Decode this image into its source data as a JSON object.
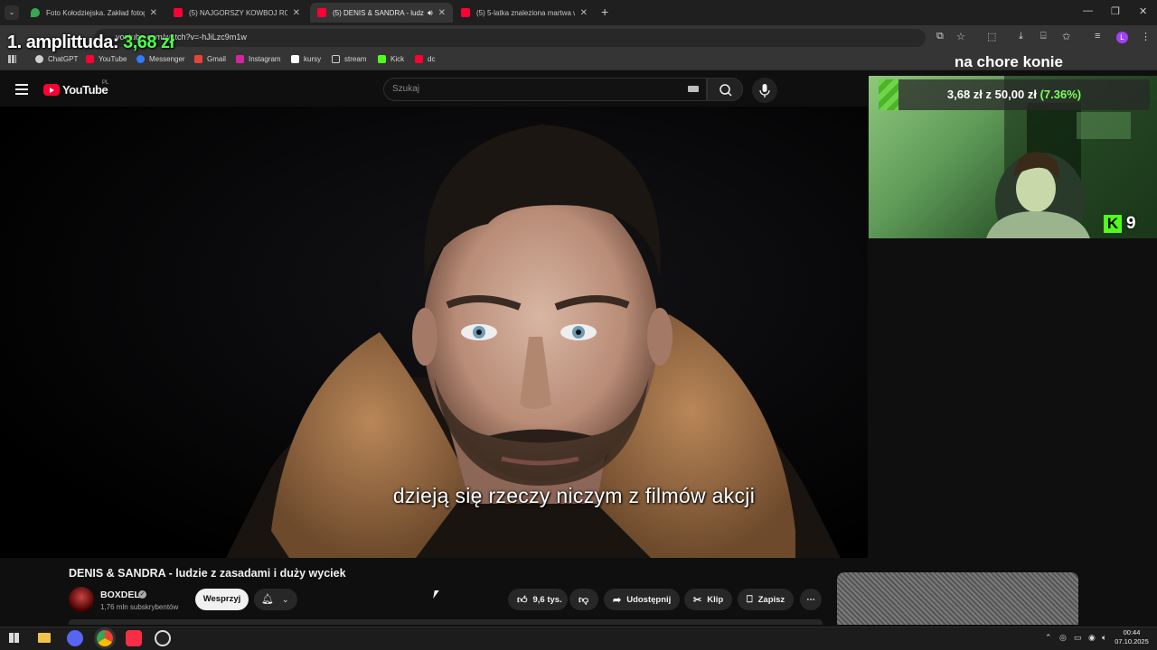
{
  "browser": {
    "tabs": [
      {
        "title": "Foto Kołodziejska. Zakład fotog",
        "favicon_color": "#34a853"
      },
      {
        "title": "(5) NAJGORSZY KOWBOJ ROBI",
        "favicon_color": "#ff0033"
      },
      {
        "title": "(5) DENIS & SANDRA - ludz",
        "favicon_color": "#ff0033",
        "active": true
      },
      {
        "title": "(5) 5-latka znaleziona martwa w",
        "favicon_color": "#ff0033"
      }
    ],
    "url": "youtube.com/watch?v=-hJiLzc9m1w",
    "profile_initial": "L",
    "bookmarks": [
      {
        "label": "ChatGPT",
        "color": "#cfcfcf"
      },
      {
        "label": "YouTube",
        "color": "#ff0033"
      },
      {
        "label": "Messenger",
        "color": "#2e7cff"
      },
      {
        "label": "Gmail",
        "color": "#ea4335"
      },
      {
        "label": "Instagram",
        "color": "#d6249f"
      },
      {
        "label": "kursy",
        "color": "#ffffff"
      },
      {
        "label": "stream",
        "color": "#cfcfcf"
      },
      {
        "label": "Kick",
        "color": "#53fc18"
      },
      {
        "label": "dc",
        "color": "#ff0033"
      }
    ]
  },
  "overlay": {
    "amplitude_label": "1. amplittuda:",
    "amplitude_value": "3,68 zł",
    "charity_title": "na chore konie",
    "goal_current": "3,68 zł",
    "goal_sep": "z",
    "goal_target": "50,00 zł",
    "goal_percent": "(7.36%)",
    "goal_fraction": 0.0736,
    "kick_logo": "K",
    "viewer_count": "9"
  },
  "youtube": {
    "logo_text": "YouTube",
    "country": "PL",
    "search_placeholder": "Szukaj",
    "subtitle": "dzieją się rzeczy niczym z filmów akcji",
    "video_title": "DENIS & SANDRA - ludzie z zasadami i duży wyciek",
    "channel_name": "BOXDEL",
    "subscribers": "1,76 mln subskrybentów",
    "support_label": "Wesprzyj",
    "likes": "9,6 tys.",
    "share_label": "Udostępnij",
    "clip_label": "Klip",
    "save_label": "Zapisz"
  },
  "taskbar": {
    "time": "00:44",
    "date": "07.10.2025"
  }
}
